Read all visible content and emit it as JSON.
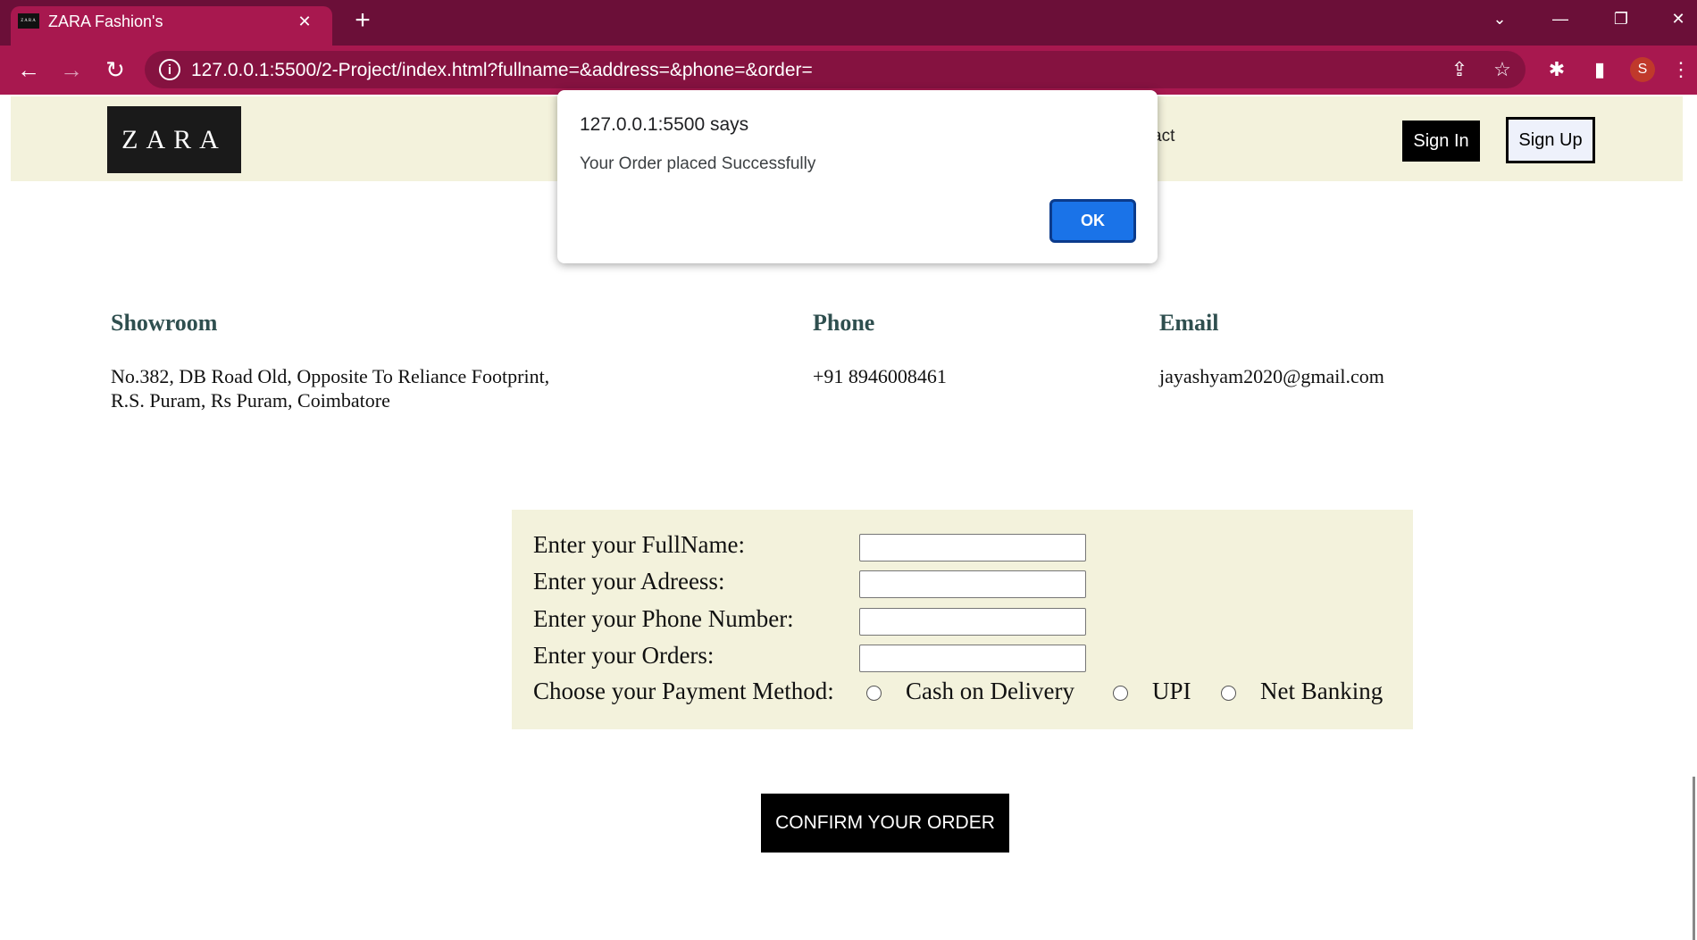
{
  "browser": {
    "tab_title": "ZARA Fashion's",
    "tab_favicon_text": "ZARA",
    "tab_close_icon": "✕",
    "new_tab_icon": "+",
    "window_controls": {
      "dropdown": "⌄",
      "minimize": "—",
      "restore": "❐",
      "close": "✕"
    },
    "nav": {
      "back": "←",
      "forward": "→",
      "reload": "↻"
    },
    "site_info_icon": "i",
    "url": "127.0.0.1:5500/2-Project/index.html?fullname=&address=&phone=&order=",
    "toolbar_icons": {
      "share": "⇪",
      "bookmark": "☆",
      "extensions": "✱",
      "sidepanel": "▮",
      "menu": "⋮"
    },
    "profile_initial": "S",
    "colors": {
      "tabbar": "#6b0f38",
      "toolbar": "#a8184f"
    }
  },
  "header": {
    "logo": "ZARA",
    "nav_contact_fragment": "act",
    "signin_label": "Sign In",
    "signup_label": "Sign Up",
    "background": "#f3f2dc"
  },
  "contact": {
    "showroom": {
      "heading": "Showroom",
      "line1": "No.382, DB Road Old, Opposite To Reliance Footprint,",
      "line2": "R.S. Puram, Rs Puram, Coimbatore"
    },
    "phone": {
      "heading": "Phone",
      "value": "+91 8946008461"
    },
    "email": {
      "heading": "Email",
      "value": "jayashyam2020@gmail.com"
    }
  },
  "form": {
    "fullname_label": "Enter your FullName:",
    "address_label": "Enter your Adreess:",
    "phone_label": "Enter your Phone Number:",
    "orders_label": "Enter your Orders:",
    "payment_label": "Choose your Payment Method:",
    "payment_options": [
      "Cash on Delivery",
      "UPI",
      "Net Banking"
    ],
    "confirm_label": "CONFIRM YOUR ORDER"
  },
  "dialog": {
    "title": "127.0.0.1:5500 says",
    "message": "Your Order placed Successfully",
    "ok_label": "OK",
    "accent": "#1a73e8"
  }
}
